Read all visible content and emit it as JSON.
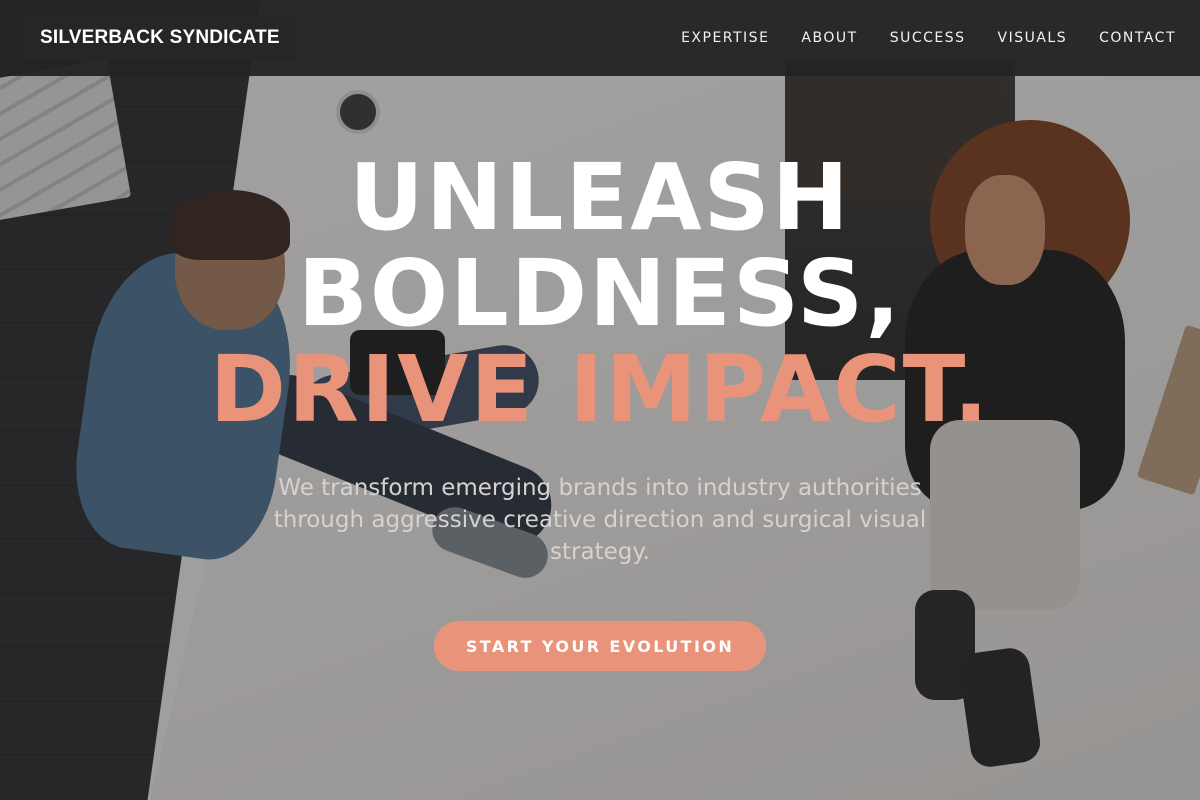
{
  "nav": {
    "brand": "SILVERBACK SYNDICATE",
    "links": [
      "EXPERTISE",
      "ABOUT",
      "SUCCESS",
      "VISUALS",
      "CONTACT"
    ]
  },
  "hero": {
    "headline_line1": "UNLEASH",
    "headline_line2": "BOLDNESS,",
    "headline_line3": "DRIVE IMPACT.",
    "subtext": "We transform emerging brands into industry authorities through aggressive creative direction and surgical visual strategy.",
    "cta_label": "START YOUR EVOLUTION",
    "background_image": "two-people-sitting-on-studio-floor"
  },
  "colors": {
    "accent": "#e8937a",
    "nav_bg": "#242424",
    "text_light": "#ffffff"
  }
}
